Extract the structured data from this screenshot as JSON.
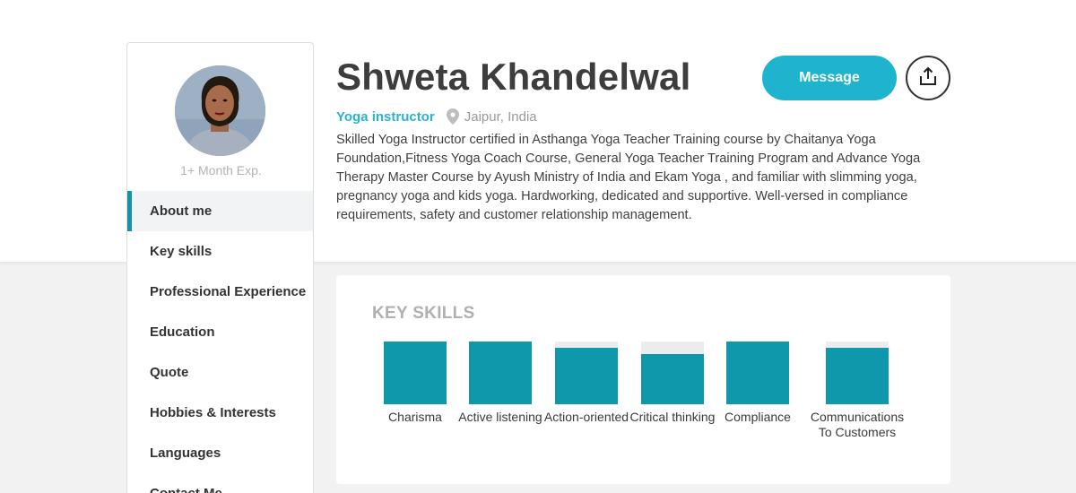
{
  "profile": {
    "name": "Shweta Khandelwal",
    "role": "Yoga instructor",
    "location": "Jaipur, India",
    "experience": "1+ Month Exp.",
    "bio": "Skilled Yoga Instructor certified in Asthanga Yoga Teacher Training course by Chaitanya Yoga Foundation,Fitness Yoga Coach Course, General Yoga Teacher Training Program and Advance Yoga Therapy Master Course by Ayush Ministry of India and Ekam Yoga , and familiar with slimming yoga, pregnancy yoga and kids yoga. Hardworking, dedicated and supportive. Well-versed in compliance requirements, safety and customer relationship management."
  },
  "actions": {
    "message_label": "Message",
    "share_icon": "share-upload-icon"
  },
  "sidebar": {
    "items": [
      {
        "label": "About me",
        "active": true
      },
      {
        "label": "Key skills",
        "active": false
      },
      {
        "label": "Professional Experience",
        "active": false
      },
      {
        "label": "Education",
        "active": false
      },
      {
        "label": "Quote",
        "active": false
      },
      {
        "label": "Hobbies & Interests",
        "active": false
      },
      {
        "label": "Languages",
        "active": false
      },
      {
        "label": "Contact Me",
        "active": false
      }
    ]
  },
  "skills": {
    "title": "KEY SKILLS",
    "items": [
      {
        "label": "Charisma",
        "level": 1.0
      },
      {
        "label": "Active listening",
        "level": 1.0
      },
      {
        "label": "Action-oriented",
        "level": 0.9
      },
      {
        "label": "Critical thinking",
        "level": 0.8
      },
      {
        "label": "Compliance",
        "level": 1.0
      },
      {
        "label": "Communications To Customers",
        "level": 0.9
      }
    ]
  },
  "colors": {
    "accent": "#1eb4cd",
    "skill_fill": "#0f97ac",
    "role_text": "#29b4cb"
  }
}
